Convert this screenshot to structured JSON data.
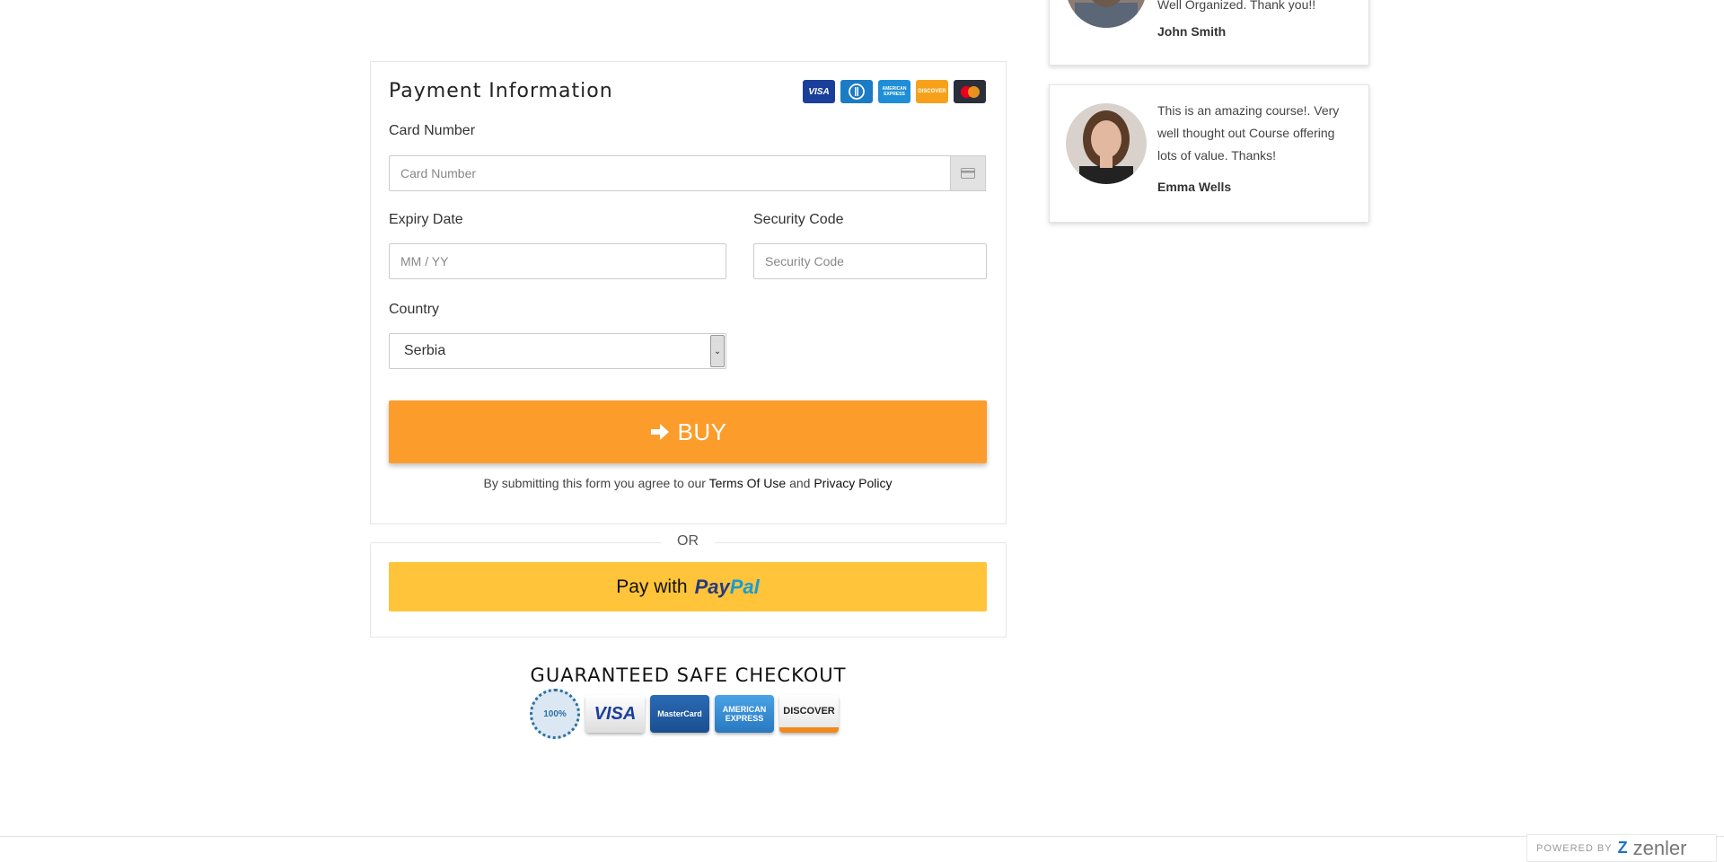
{
  "payment": {
    "title": "Payment Information",
    "card_logos": [
      "VISA",
      "Diners Club",
      "AMERICAN EXPRESS",
      "DISCOVER",
      "MasterCard"
    ],
    "card_number_label": "Card Number",
    "card_number_placeholder": "Card Number",
    "expiry_label": "Expiry Date",
    "expiry_placeholder": "MM / YY",
    "security_label": "Security Code",
    "security_placeholder": "Security Code",
    "country_label": "Country",
    "country_value": "Serbia",
    "buy_label": "BUY",
    "terms_prefix": "By submitting this form you agree to our",
    "terms_link": "Terms Of Use",
    "terms_and": "and",
    "privacy_link": "Privacy Policy"
  },
  "or_text": "OR",
  "paypal": {
    "prefix": "Pay with",
    "logo_part1": "Pay",
    "logo_part2": "Pal"
  },
  "safe_checkout": {
    "title": "GUARANTEED SAFE CHECKOUT",
    "seal": "100%",
    "logos": [
      "VISA",
      "MasterCard",
      "AMERICAN EXPRESS",
      "DISCOVER"
    ]
  },
  "testimonials": [
    {
      "quote": "Well Organized. Thank you!!",
      "name": "John Smith"
    },
    {
      "quote": "This is an amazing course!. Very well thought out Course offering lots of value. Thanks!",
      "name": "Emma Wells"
    }
  ],
  "footer": {
    "powered_by": "POWERED BY",
    "brand": "zenler"
  },
  "colors": {
    "buy_button": "#fc9c2b",
    "paypal_button": "#ffc439",
    "paypal_dark": "#253b80",
    "paypal_light": "#179bd7"
  }
}
